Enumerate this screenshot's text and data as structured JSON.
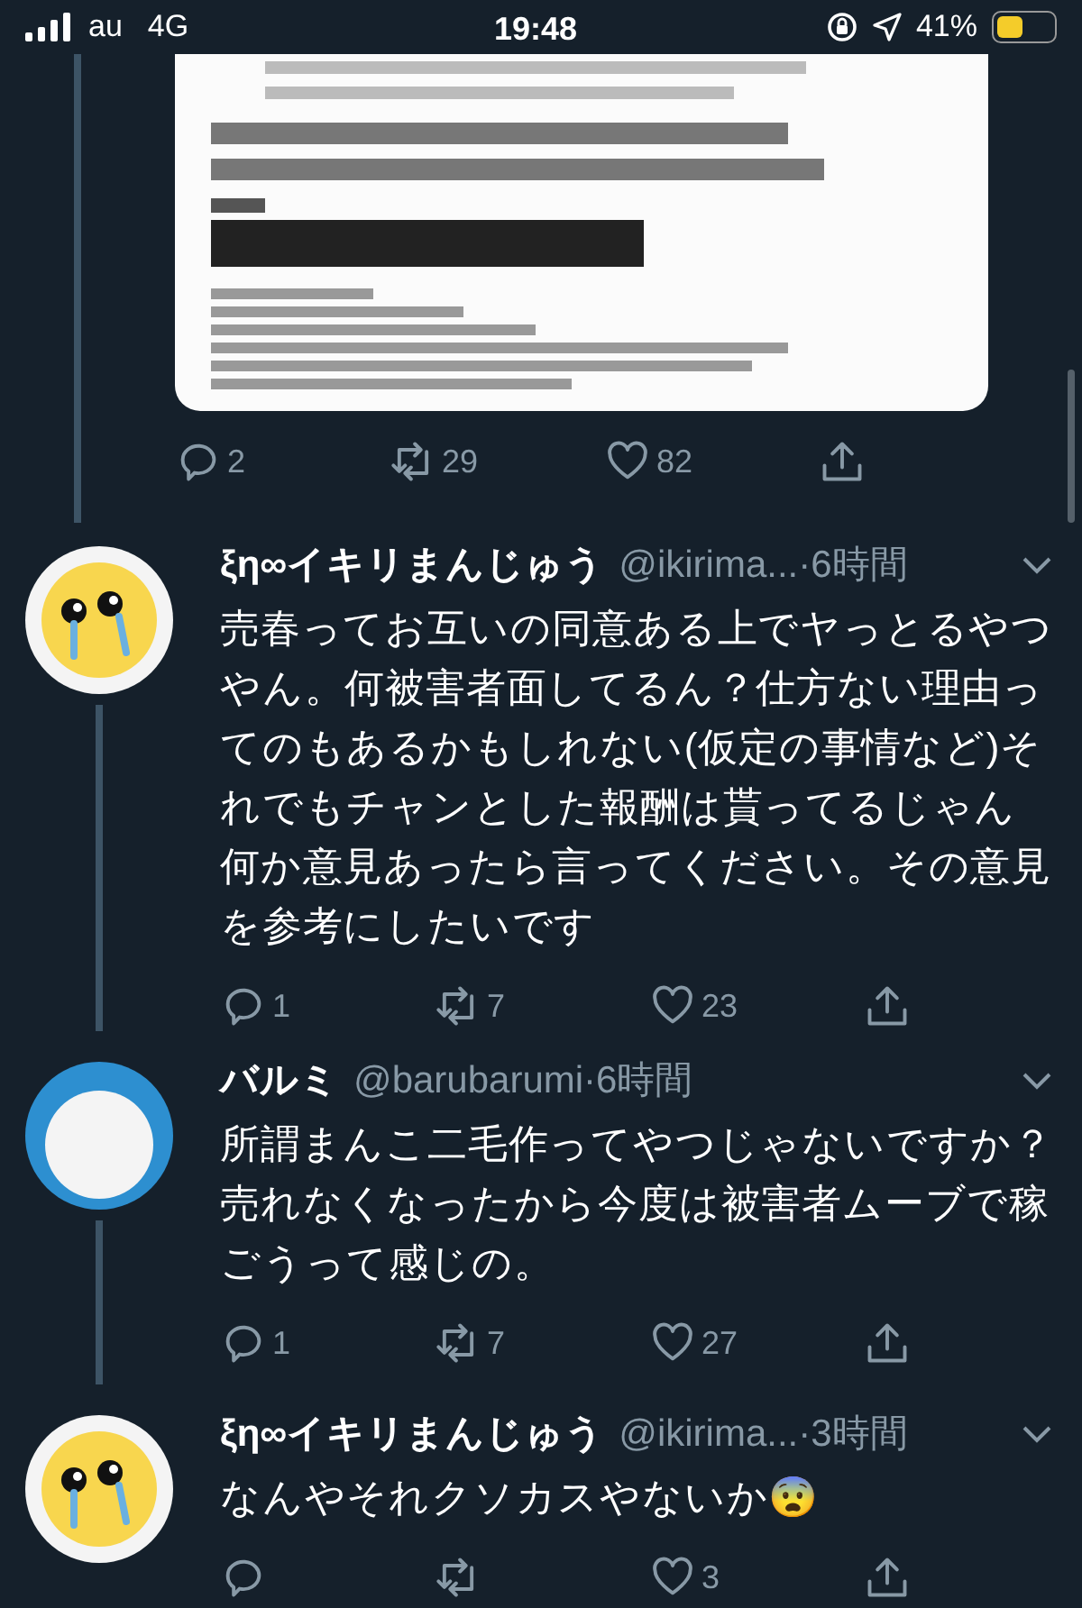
{
  "status_bar": {
    "carrier": "au",
    "network": "4G",
    "time": "19:48",
    "battery": "41%"
  },
  "media_tweet": {
    "reply_count": "2",
    "retweet_count": "29",
    "like_count": "82"
  },
  "tweets": [
    {
      "name": "ξη∞イキリまんじゅう",
      "handle": "@ikirima...",
      "time": "·6時間",
      "text": [
        "売春ってお互いの同意ある上でヤっとるやつやん。何被害者面してるん？仕方ない理由ってのもあるかもしれない(仮定の事情など)それでもチャンとした報酬は貰ってるじゃん",
        "何か意見あったら言ってください。その意見を参考にしたいです"
      ],
      "reply_count": "1",
      "retweet_count": "7",
      "like_count": "23",
      "connected_below": true
    },
    {
      "name": "バルミ",
      "handle": "@barubarumi",
      "time": "·6時間",
      "text": [
        "所謂まんこ二毛作ってやつじゃないですか？売れなくなったから今度は被害者ムーブで稼ごうって感じの。"
      ],
      "reply_count": "1",
      "retweet_count": "7",
      "like_count": "27",
      "connected_below": true
    },
    {
      "name": "ξη∞イキリまんじゅう",
      "handle": "@ikirima...",
      "time": "·3時間",
      "text": [
        "なんやそれクソカスやないか😨"
      ],
      "like_count": "3",
      "connected_below": false
    }
  ]
}
